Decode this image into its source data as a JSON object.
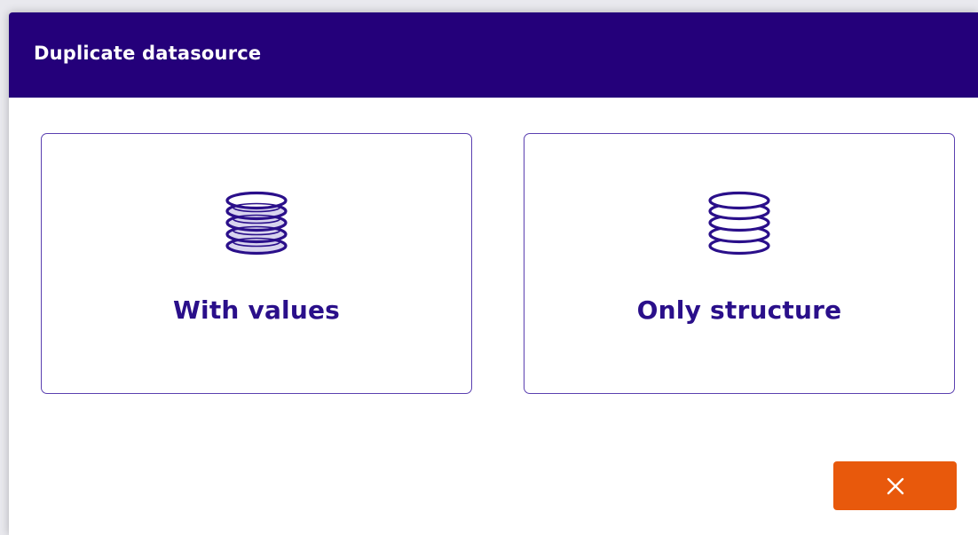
{
  "dialog": {
    "title": "Duplicate datasource"
  },
  "options": [
    {
      "label": "With values",
      "icon": "database-filled-icon"
    },
    {
      "label": "Only structure",
      "icon": "database-outline-icon"
    }
  ],
  "close_button": {
    "icon": "close-icon"
  },
  "colors": {
    "header_bg": "#24007a",
    "accent": "#2a0f8a",
    "close_button_bg": "#e8590c"
  }
}
